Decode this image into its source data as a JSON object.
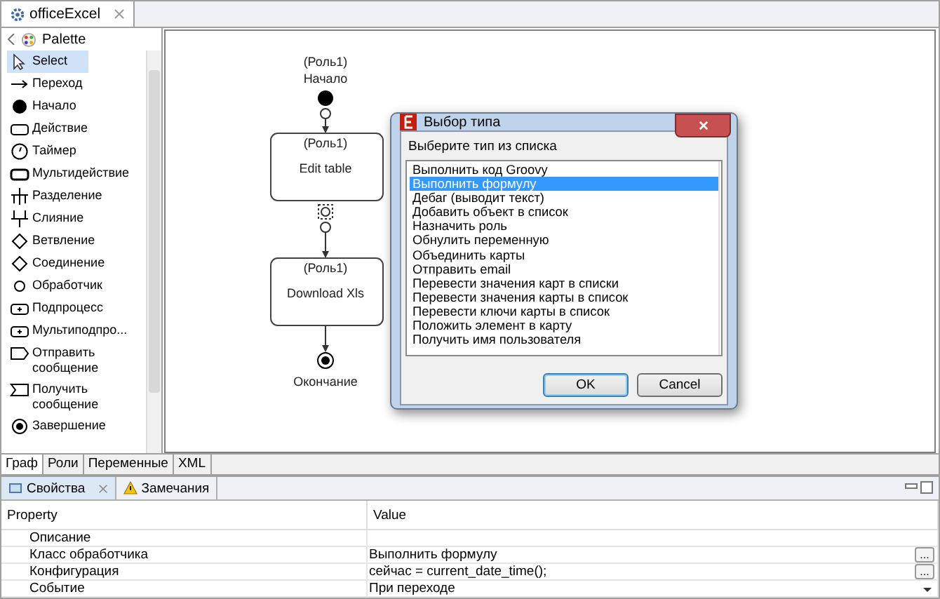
{
  "editor_tab": {
    "title": "officeExcel"
  },
  "palette": {
    "title": "Palette",
    "items": [
      {
        "label": "Select",
        "kind": "select",
        "selected": true
      },
      {
        "label": "Переход",
        "kind": "arrow",
        "selected": false
      },
      {
        "label": "Начало",
        "kind": "start",
        "selected": false
      },
      {
        "label": "Действие",
        "kind": "action",
        "selected": false
      },
      {
        "label": "Таймер",
        "kind": "timer",
        "selected": false
      },
      {
        "label": "Мультидействие",
        "kind": "multiaction",
        "selected": false
      },
      {
        "label": "Разделение",
        "kind": "fork",
        "selected": false
      },
      {
        "label": "Слияние",
        "kind": "join",
        "selected": false
      },
      {
        "label": "Ветвление",
        "kind": "diamond",
        "selected": false
      },
      {
        "label": "Соединение",
        "kind": "diamond",
        "selected": false
      },
      {
        "label": "Обработчик",
        "kind": "handler",
        "selected": false
      },
      {
        "label": "Подпроцесс",
        "kind": "subprocess",
        "selected": false
      },
      {
        "label": "Мультиподпро...",
        "kind": "subprocess",
        "selected": false
      },
      {
        "label": "Отправить сообщение",
        "kind": "send",
        "selected": false
      },
      {
        "label": "Получить сообщение",
        "kind": "receive",
        "selected": false
      },
      {
        "label": "Завершение",
        "kind": "end",
        "selected": false
      }
    ]
  },
  "diagram": {
    "start": {
      "role": "(Роль1)",
      "label": "Начало"
    },
    "tasks": [
      {
        "role": "(Роль1)",
        "label": "Edit table",
        "selected": false
      },
      {
        "role": "(Роль1)",
        "label": "Download Xls",
        "selected": false
      }
    ],
    "end": {
      "label": "Окончание"
    }
  },
  "editor_pages": [
    {
      "label": "Граф",
      "selected": true
    },
    {
      "label": "Роли",
      "selected": false
    },
    {
      "label": "Переменные",
      "selected": false
    },
    {
      "label": "XML",
      "selected": false
    }
  ],
  "dialog": {
    "title": "Выбор типа",
    "prompt": "Выберите тип из списка",
    "items": [
      {
        "label": "Выполнить код Groovy",
        "selected": false
      },
      {
        "label": "Выполнить формулу",
        "selected": true
      },
      {
        "label": "Дебаг (выводит текст)",
        "selected": false
      },
      {
        "label": "Добавить объект в список",
        "selected": false
      },
      {
        "label": "Назначить роль",
        "selected": false
      },
      {
        "label": "Обнулить переменную",
        "selected": false
      },
      {
        "label": "Объединить карты",
        "selected": false
      },
      {
        "label": "Отправить email",
        "selected": false
      },
      {
        "label": "Перевести значения карт в списки",
        "selected": false
      },
      {
        "label": "Перевести значения карты в список",
        "selected": false
      },
      {
        "label": "Перевести ключи карты в список",
        "selected": false
      },
      {
        "label": "Положить элемент в карту",
        "selected": false
      },
      {
        "label": "Получить имя пользователя",
        "selected": false
      }
    ],
    "buttons": [
      "OK",
      "Cancel"
    ]
  },
  "bottom_tabs": [
    {
      "label": "Свойства",
      "selected": true,
      "kind": "properties"
    },
    {
      "label": "Замечания",
      "selected": false,
      "kind": "problems"
    }
  ],
  "properties": {
    "columns": [
      "Property",
      "Value"
    ],
    "rows": [
      {
        "property": "Описание",
        "value": "",
        "kind": "plain"
      },
      {
        "property": "Класс обработчика",
        "value": "Выполнить формулу",
        "kind": "ellipsis",
        "button": "..."
      },
      {
        "property": "Конфигурация",
        "value": "сейчас = current_date_time();",
        "kind": "ellipsis",
        "button": "..."
      },
      {
        "property": "Событие",
        "value": "При переходе",
        "kind": "dropdown"
      }
    ]
  }
}
